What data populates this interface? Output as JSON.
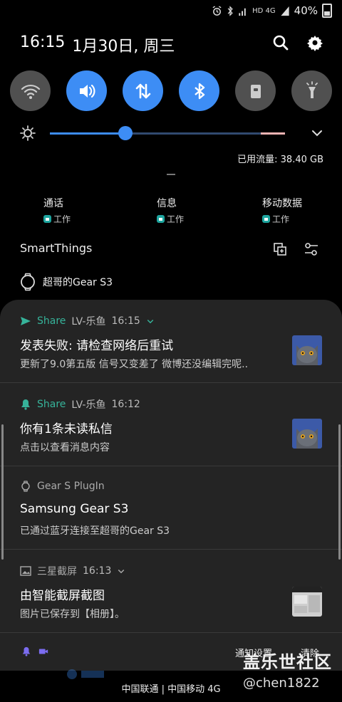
{
  "status_bar": {
    "battery": "40%",
    "network_label": "HD 4G",
    "icons": [
      "alarm-icon",
      "bluetooth-icon",
      "signal-icon",
      "signal-icon",
      "battery-icon"
    ]
  },
  "header": {
    "time": "16:15",
    "date": "1月30日, 周三",
    "actions": [
      "search-icon",
      "settings-icon"
    ]
  },
  "quick_toggles": [
    {
      "name": "wifi",
      "icon": "wifi-icon",
      "state": "off"
    },
    {
      "name": "sound",
      "icon": "volume-icon",
      "state": "on"
    },
    {
      "name": "mobile-data",
      "icon": "data-transfer-icon",
      "state": "on"
    },
    {
      "name": "bluetooth",
      "icon": "bluetooth-icon",
      "state": "on"
    },
    {
      "name": "screen-lock",
      "icon": "lock-icon",
      "state": "off"
    },
    {
      "name": "flashlight",
      "icon": "flashlight-icon",
      "state": "off"
    }
  ],
  "brightness": {
    "level": 0.32
  },
  "data_usage": "已用流量: 38.40 GB",
  "sim_shortcuts": [
    {
      "title": "通话",
      "sub": "工作"
    },
    {
      "title": "信息",
      "sub": "工作"
    },
    {
      "title": "移动数据",
      "sub": "工作"
    }
  ],
  "smartthings": {
    "title": "SmartThings",
    "device": "超哥的Gear S3"
  },
  "notifications": [
    {
      "app": "Share",
      "sender": "LV-乐鱼",
      "time": "16:15",
      "title": "发表失败: 请检查网络后重试",
      "text": "更新了9.0第五版  信号又变差了  微博还没编辑完呢.."
    },
    {
      "app": "Share",
      "sender": "LV-乐鱼",
      "time": "16:12",
      "title": "你有1条未读私信",
      "text": "点击以查看消息内容"
    },
    {
      "app": "Gear S PlugIn",
      "sender": "",
      "time": "",
      "title": "Samsung Gear S3",
      "text": "已通过蓝牙连接至超哥的Gear S3"
    },
    {
      "app": "三星截屏",
      "sender": "",
      "time": "16:13",
      "title": "由智能截屏截图",
      "text": "图片已保存到【相册】。"
    }
  ],
  "footer": {
    "notify_settings": "通知设置",
    "clear": "清除"
  },
  "carrier": "中国联通 | 中国移动 4G",
  "watermark": {
    "line1": "盖乐世社区",
    "line2": "@chen1822"
  },
  "colors": {
    "accent": "#3d8df5",
    "share_green": "#36b39a",
    "panel": "#242424"
  }
}
